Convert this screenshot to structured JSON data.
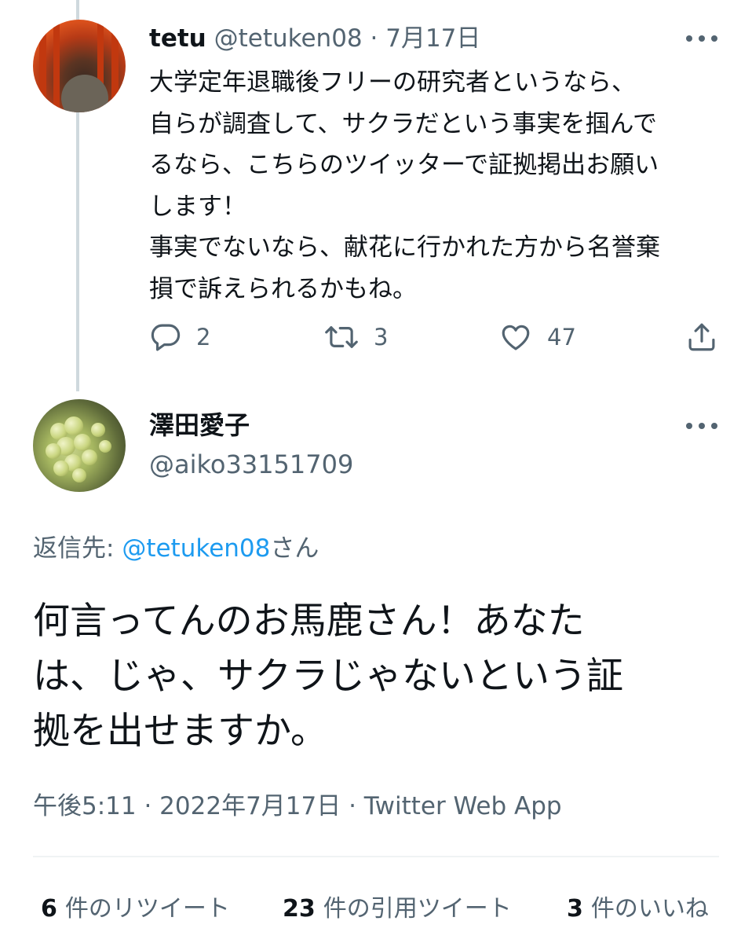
{
  "parent_tweet": {
    "display_name": "tetu",
    "handle": "@tetuken08",
    "separator": "·",
    "date": "7月17日",
    "text": "大学定年退職後フリーの研究者というなら、\n自らが調査して、サクラだという事実を掴んで\nるなら、こちらのツイッターで証拠掲出お願い\nします！\n事実でないなら、献花に行かれた方から名誉棄\n損で訴えられるかもね。",
    "replies": "2",
    "retweets": "3",
    "likes": "47"
  },
  "reply_tweet": {
    "display_name": "澤田愛子",
    "handle": "@aiko33151709",
    "reply_prefix": "返信先: ",
    "reply_target": "@tetuken08",
    "reply_suffix": "さん",
    "text": "何言ってんのお馬鹿さん！あなた\nは、じゃ、サクラじゃないという証\n拠を出せますか。",
    "timestamp": "午後5:11 · 2022年7月17日 · Twitter Web App"
  },
  "stats": {
    "retweets_count": "6",
    "retweets_label": "件のリツイート",
    "quotes_count": "23",
    "quotes_label": "件の引用ツイート",
    "likes_count": "3",
    "likes_label": "件のいいね"
  },
  "icons": {
    "reply": "speech-bubble-icon",
    "retweet": "retweet-arrows-icon",
    "like": "heart-icon",
    "share": "share-upload-icon",
    "more": "more-dots-icon"
  },
  "colors": {
    "text": "#0f1419",
    "muted": "#536471",
    "link": "#1d9bf0",
    "thread_line": "#cfd9de"
  }
}
